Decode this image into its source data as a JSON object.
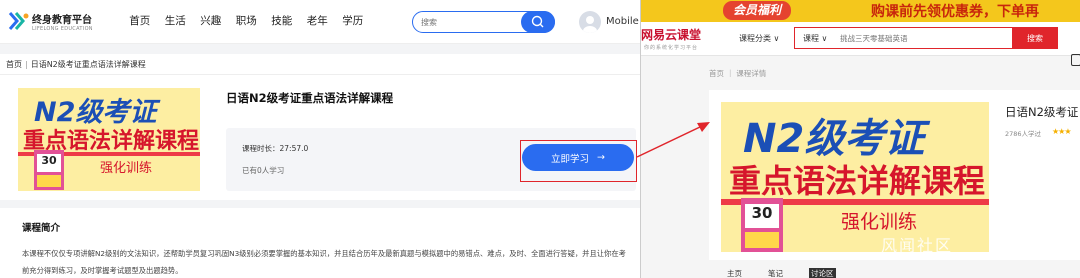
{
  "left": {
    "logo": {
      "title": "终身教育平台",
      "subtitle": "LIFELONG EDUCATION"
    },
    "nav": [
      "首页",
      "生活",
      "兴趣",
      "职场",
      "技能",
      "老年",
      "学历"
    ],
    "search": {
      "placeholder": "搜索"
    },
    "user": {
      "name": "Mobile"
    },
    "breadcrumb": {
      "home": "首页",
      "separator": "|",
      "current": "日语N2级考证重点语法详解课程"
    },
    "course": {
      "title": "日语N2级考证重点语法详解课程",
      "duration": "课程时长：27:57.0",
      "learners": "已有0人学习",
      "study_button": "立即学习",
      "study_arrow": "→"
    },
    "cover": {
      "line1": "N2级考证",
      "line2": "重点语法详解课程",
      "line3": "强化训练",
      "book_badge": "30"
    },
    "intro": {
      "title": "课程简介",
      "text": "本课程不仅仅专项讲解N2级别的文法知识，还帮助学员复习巩固N3级别必须要掌握的基本知识，并且结合历年及最新真题与模拟题中的易错点、难点，及时、全面进行答疑，并且让你在考前充分得到练习，及时掌握考试题型及出题趋势。"
    }
  },
  "right": {
    "banner": {
      "badge": "会员福利",
      "text": "购课前先领优惠券，下单再"
    },
    "logo": {
      "title": "网易云课堂",
      "subtitle": "你的系统化学习平台"
    },
    "category_menu": "课程分类 ∨",
    "search": {
      "category": "课程 ∨",
      "placeholder": "挑战三天零基础英语",
      "button": "搜索"
    },
    "breadcrumb": "首页 ｜ 课程详情",
    "course": {
      "title": "日语N2级考证",
      "meta": "2786人学过",
      "stars": "★★★"
    },
    "tabs": [
      "主页",
      "笔记",
      "讨论区"
    ],
    "watermark": "风闻社区"
  },
  "colors": {
    "primary_blue": "#2a6cf0",
    "highlight_red": "#e0252b",
    "banner_yellow": "#f4c71c"
  }
}
